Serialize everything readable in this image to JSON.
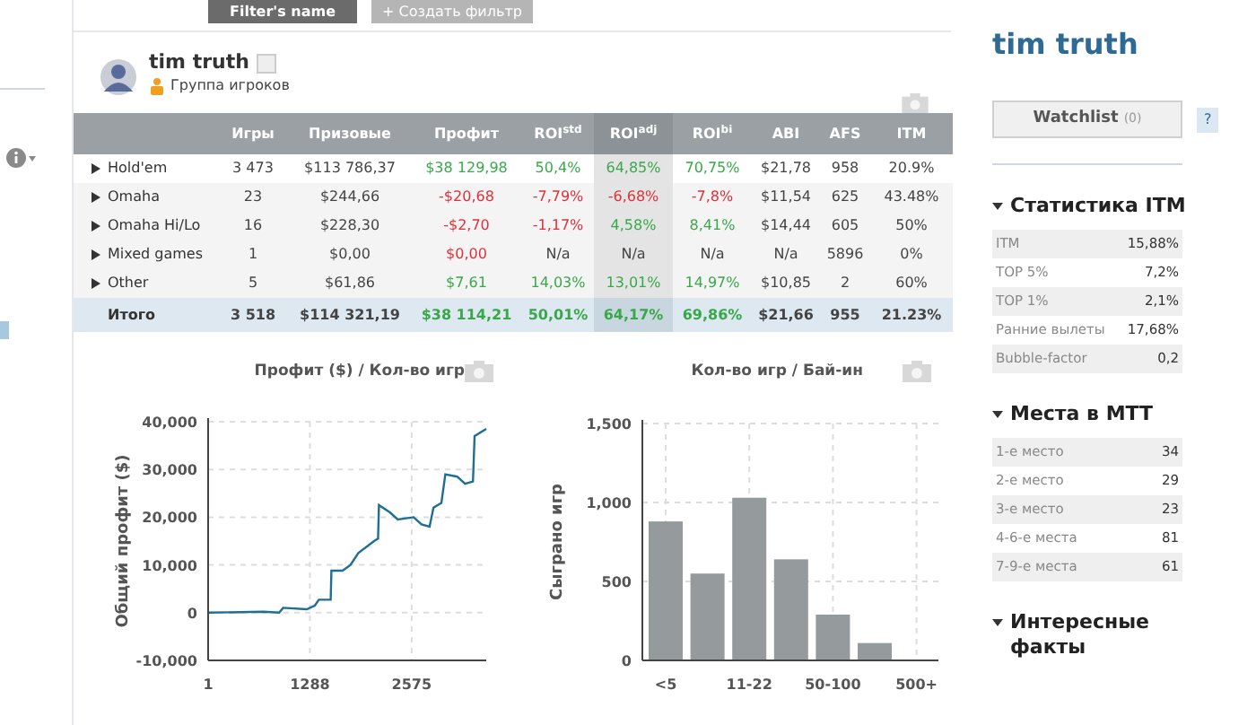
{
  "filters": {
    "name_button": "Filter's name",
    "create_button": "+ Создать фильтр"
  },
  "player": {
    "name": "tim truth",
    "group": "Группа игроков"
  },
  "table": {
    "columns": [
      "Игры",
      "Призовые",
      "Профит",
      "ROI$^{std}$",
      "ROI$^{adj}$",
      "ROI$^{bi}$",
      "ABI",
      "AFS",
      "ITM"
    ],
    "rows": [
      {
        "label": "Hold'em",
        "expandable": true,
        "total": false,
        "cells": [
          {
            "text": "3 473"
          },
          {
            "text": "$113 786,37"
          },
          {
            "text": "$38 129,98",
            "color": "#3aa84a"
          },
          {
            "text": "50,4%",
            "color": "#3aa84a"
          },
          {
            "text": "64,85%",
            "color": "#3aa84a"
          },
          {
            "text": "70,75%",
            "color": "#3aa84a"
          },
          {
            "text": "$21,78"
          },
          {
            "text": "958"
          },
          {
            "text": "20.9%"
          }
        ]
      },
      {
        "label": "Omaha",
        "expandable": true,
        "total": false,
        "cells": [
          {
            "text": "23"
          },
          {
            "text": "$244,66"
          },
          {
            "text": "-$20,68",
            "color": "#e0303a"
          },
          {
            "text": "-7,79%",
            "color": "#e0303a"
          },
          {
            "text": "-6,68%",
            "color": "#e0303a"
          },
          {
            "text": "-7,8%",
            "color": "#e0303a"
          },
          {
            "text": "$11,54"
          },
          {
            "text": "625"
          },
          {
            "text": "43.48%"
          }
        ]
      },
      {
        "label": "Omaha Hi/Lo",
        "expandable": true,
        "total": false,
        "cells": [
          {
            "text": "16"
          },
          {
            "text": "$228,30"
          },
          {
            "text": "-$2,70",
            "color": "#e0303a"
          },
          {
            "text": "-1,17%",
            "color": "#e0303a"
          },
          {
            "text": "4,58%",
            "color": "#3aa84a"
          },
          {
            "text": "8,41%",
            "color": "#3aa84a"
          },
          {
            "text": "$14,44"
          },
          {
            "text": "605"
          },
          {
            "text": "50%"
          }
        ]
      },
      {
        "label": "Mixed games",
        "expandable": true,
        "total": false,
        "cells": [
          {
            "text": "1"
          },
          {
            "text": "$0,00"
          },
          {
            "text": "$0,00",
            "color": "#e0303a"
          },
          {
            "text": "N/a"
          },
          {
            "text": "N/a"
          },
          {
            "text": "N/a"
          },
          {
            "text": "N/a"
          },
          {
            "text": "5896"
          },
          {
            "text": "0%"
          }
        ]
      },
      {
        "label": "Other",
        "expandable": true,
        "total": false,
        "cells": [
          {
            "text": "5"
          },
          {
            "text": "$61,86"
          },
          {
            "text": "$7,61",
            "color": "#3aa84a"
          },
          {
            "text": "14,03%",
            "color": "#3aa84a"
          },
          {
            "text": "13,01%",
            "color": "#3aa84a"
          },
          {
            "text": "14,97%",
            "color": "#3aa84a"
          },
          {
            "text": "$10,85"
          },
          {
            "text": "2"
          },
          {
            "text": "60%"
          }
        ]
      },
      {
        "label": "Итого",
        "expandable": false,
        "total": true,
        "cells": [
          {
            "text": "3 518"
          },
          {
            "text": "$114 321,19"
          },
          {
            "text": "$38 114,21",
            "color": "#3aa84a"
          },
          {
            "text": "50,01%",
            "color": "#3aa84a"
          },
          {
            "text": "64,17%",
            "color": "#3aa84a"
          },
          {
            "text": "69,86%",
            "color": "#3aa84a"
          },
          {
            "text": "$21,66"
          },
          {
            "text": "955"
          },
          {
            "text": "21.23%"
          }
        ]
      }
    ]
  },
  "profit_chart": {
    "chart_data": {
      "type": "line",
      "title": "Профит ($) / Кол-во игр",
      "ylabel": "Общий профит ($)",
      "grid": true,
      "xlim": [
        1,
        3518
      ],
      "ylim": [
        -10000,
        40000
      ],
      "xticks": [
        1,
        1288,
        2575
      ],
      "yticks": [
        {
          "value": -10000,
          "label": "-10,000"
        },
        {
          "value": 0,
          "label": "0"
        },
        {
          "value": 10000,
          "label": "10,000"
        },
        {
          "value": 20000,
          "label": "20,000"
        },
        {
          "value": 30000,
          "label": "30,000"
        },
        {
          "value": 40000,
          "label": "40,000"
        }
      ],
      "x": [
        1,
        700,
        900,
        950,
        1250,
        1350,
        1400,
        1550,
        1560,
        1700,
        1800,
        1900,
        2100,
        2150,
        2160,
        2300,
        2400,
        2600,
        2700,
        2800,
        2850,
        2950,
        3000,
        3150,
        3250,
        3350,
        3370,
        3518
      ],
      "series": [
        {
          "color": "#1f6e94",
          "values": [
            0,
            200,
            0,
            1000,
            700,
            1500,
            2700,
            2700,
            8800,
            8800,
            10000,
            12500,
            15000,
            15500,
            22500,
            21000,
            19500,
            20000,
            18500,
            18000,
            22000,
            23000,
            29000,
            28500,
            27000,
            27500,
            37000,
            38500
          ]
        }
      ]
    }
  },
  "buyin_chart": {
    "chart_data": {
      "type": "bar",
      "title": "Кол-во игр / Бай-ин",
      "ylabel": "Сыграно игр",
      "grid": true,
      "categories": [
        "<5",
        null,
        "11-22",
        null,
        "50-100",
        null,
        "500+"
      ],
      "ylim": [
        0,
        1500
      ],
      "yticks": [
        {
          "value": 0,
          "label": "0"
        },
        {
          "value": 500,
          "label": "500"
        },
        {
          "value": 1000,
          "label": "1,000"
        },
        {
          "value": 1500,
          "label": "1,500"
        }
      ],
      "series": [
        {
          "color": "#959b9c",
          "values": [
            880,
            550,
            1030,
            640,
            290,
            110,
            0
          ]
        }
      ]
    }
  },
  "sidebar": {
    "title": "tim truth",
    "watchlist": {
      "label": "Watchlist",
      "count": "(0)"
    },
    "help": "?",
    "sections": [
      {
        "title": "Статистика ITM",
        "expanded": true,
        "rows": [
          {
            "label": "ITM",
            "value": "15,88%"
          },
          {
            "label": "TOP 5%",
            "value": "7,2%"
          },
          {
            "label": "TOP 1%",
            "value": "2,1%"
          },
          {
            "label": "Ранние вылеты",
            "value": "17,68%"
          },
          {
            "label": "Bubble-factor",
            "value": "0,2"
          }
        ]
      },
      {
        "title": "Места в MTT",
        "expanded": true,
        "rows": [
          {
            "label": "1-е место",
            "value": "34"
          },
          {
            "label": "2-е место",
            "value": "29"
          },
          {
            "label": "3-е место",
            "value": "23"
          },
          {
            "label": "4-6-е места",
            "value": "81"
          },
          {
            "label": "7-9-е места",
            "value": "61"
          }
        ]
      },
      {
        "title": "Интересные факты",
        "expanded": true
      }
    ]
  }
}
